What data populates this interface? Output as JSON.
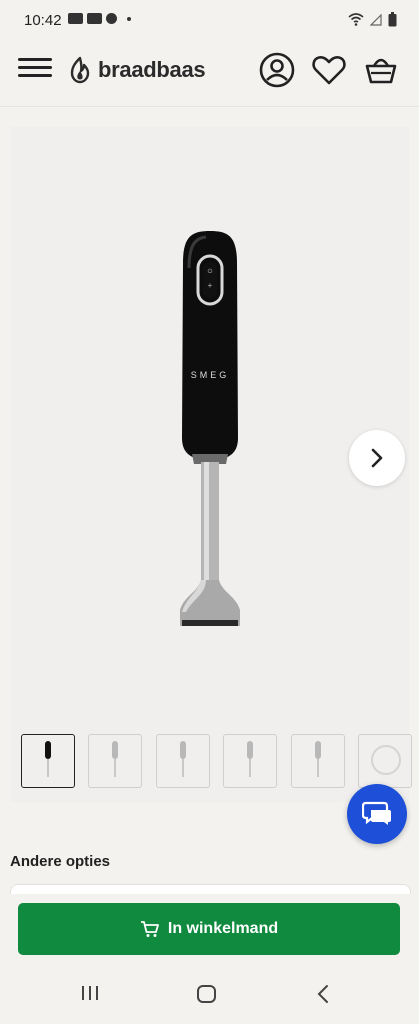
{
  "status_bar": {
    "time": "10:42"
  },
  "header": {
    "brand_name": "braadbaas"
  },
  "gallery": {
    "product_brand_mark": "SMEG",
    "thumbnail_count": 6,
    "active_index": 0
  },
  "sections": {
    "other_options_title": "Andere opties"
  },
  "cart": {
    "add_to_cart_label": "In winkelmand"
  },
  "colors": {
    "accent_green": "#0f8a3f",
    "chat_blue": "#1d4fd8",
    "background": "#f3f2ef"
  },
  "icons": [
    "menu-icon",
    "logo-flame-icon",
    "account-icon",
    "heart-icon",
    "basket-icon",
    "chevron-right-icon",
    "chat-icon",
    "cart-icon",
    "recents-icon",
    "home-icon",
    "back-icon"
  ]
}
